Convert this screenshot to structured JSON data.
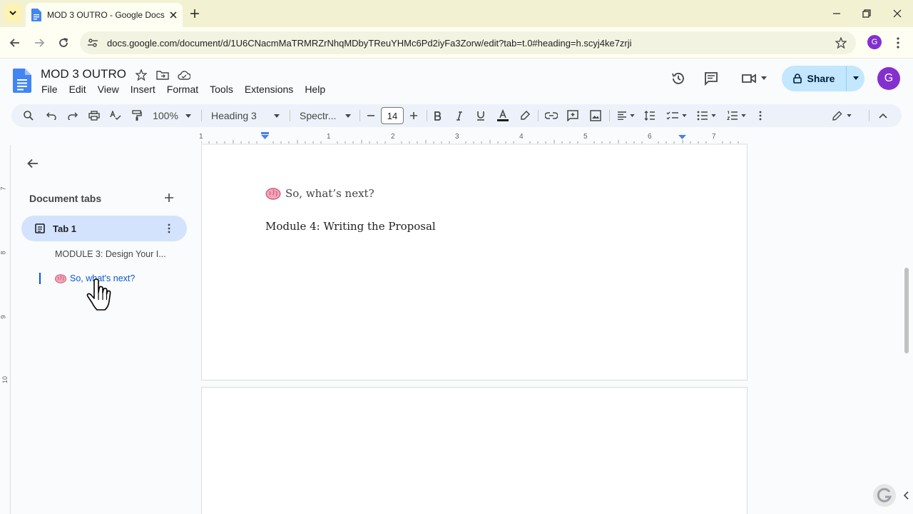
{
  "browser": {
    "tab_title": "MOD 3 OUTRO - Google Docs",
    "url": "docs.google.com/document/d/1U6CNacmMaTRMRZrNhqMDbyTReuYHMc6Pd2iyFa3Zorw/edit?tab=t.0#heading=h.scyj4ke7zrji",
    "profile_initial": "G"
  },
  "doc": {
    "title": "MOD 3 OUTRO",
    "menu": [
      "File",
      "Edit",
      "View",
      "Insert",
      "Format",
      "Tools",
      "Extensions",
      "Help"
    ],
    "share_label": "Share",
    "avatar_initial": "G"
  },
  "toolbar": {
    "zoom": "100%",
    "style": "Heading 3",
    "font": "Spectr...",
    "font_size": "14"
  },
  "ruler": {
    "numbers": [
      "1",
      "1",
      "2",
      "3",
      "4",
      "5",
      "6",
      "7"
    ]
  },
  "vruler": {
    "numbers": [
      "7",
      "8",
      "9",
      "10"
    ]
  },
  "sidebar": {
    "heading": "Document tabs",
    "tab_label": "Tab 1",
    "outline": [
      {
        "text": "MODULE 3: Design Your I..."
      },
      {
        "text": "So, what's next?"
      }
    ]
  },
  "content": {
    "heading": "So, what’s next?",
    "body": "Module 4: Writing the Proposal"
  },
  "colors": {
    "accent": "#0b57d0",
    "share_bg": "#c2e7ff",
    "tab_bg": "#d3e3fd",
    "avatar": "#8430ce"
  }
}
